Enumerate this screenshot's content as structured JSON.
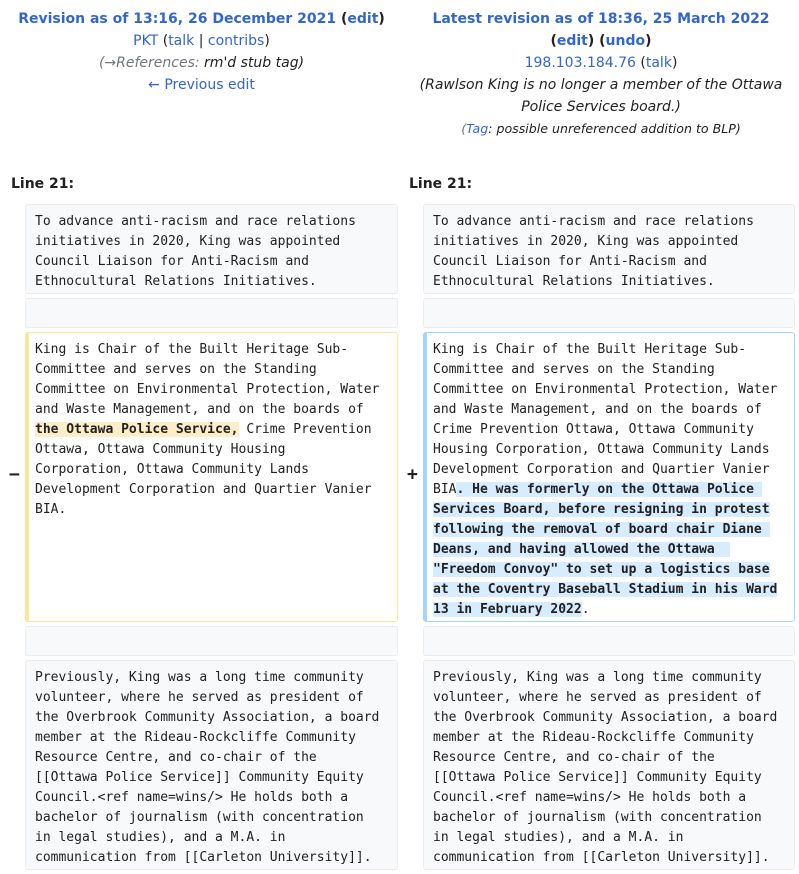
{
  "left": {
    "title_prefix": "Revision as of 13:16, 26 December 2021",
    "edit_label": "edit",
    "user": "PKT",
    "talk": "talk",
    "contribs": "contribs",
    "comment_arrow": "(→References: ",
    "comment_text": "rm'd stub tag)",
    "prev_edit": "← Previous edit",
    "line_label": "Line 21:"
  },
  "right": {
    "title_prefix": "Latest revision as of 18:36, 25 March 2022",
    "edit_label": "edit",
    "undo_label": "undo",
    "user": "198.103.184.76",
    "talk": "talk",
    "comment": "(Rawlson King is no longer a member of the Ottawa Police Services board.)",
    "tag_label": "Tag",
    "tag_text": ": possible unreferenced addition to BLP)",
    "line_label": "Line 21:"
  },
  "diff": {
    "context1": "To advance anti-racism and race relations\ninitiatives in 2020, King was appointed\nCouncil Liaison for Anti-Racism and\nEthnocultural Relations Initiatives.",
    "del_before": "King is Chair of the Built Heritage Sub-\nCommittee and serves on the Standing\nCommittee on Environmental Protection, Water\nand Waste Management, and on the boards of ",
    "del_highlight": "\nthe Ottawa Police Service,",
    "del_after": " Crime Prevention\nOttawa, Ottawa Community Housing\nCorporation, Ottawa Community Lands\nDevelopment Corporation and Quartier Vanier\nBIA.",
    "add_before": "King is Chair of the Built Heritage Sub-\nCommittee and serves on the Standing\nCommittee on Environmental Protection, Water\nand Waste Management, and on the boards of\nCrime Prevention Ottawa, Ottawa Community\nHousing Corporation, Ottawa Community Lands\nDevelopment Corporation and Quartier Vanier\nBIA",
    "add_highlight": ". He was formerly on the Ottawa Police \nServices Board, before resigning in protest\nfollowing the removal of board chair Diane \nDeans, and having allowed the Ottawa  \n\"Freedom Convoy\" to set up a logistics base\nat the Coventry Baseball Stadium in his Ward\n13 in February 2022",
    "add_after": ".",
    "context2": "Previously, King was a long time community\nvolunteer, where he served as president of\nthe Overbrook Community Association, a board\nmember at the Rideau-Rockcliffe Community\nResource Centre, and co-chair of the\n[[Ottawa Police Service]] Community Equity\nCouncil.<ref name=wins/> He holds both a\nbachelor of journalism (with concentration\nin legal studies), and a M.A. in\ncommunication from [[Carleton University]].",
    "minus": "−",
    "plus": "+"
  }
}
